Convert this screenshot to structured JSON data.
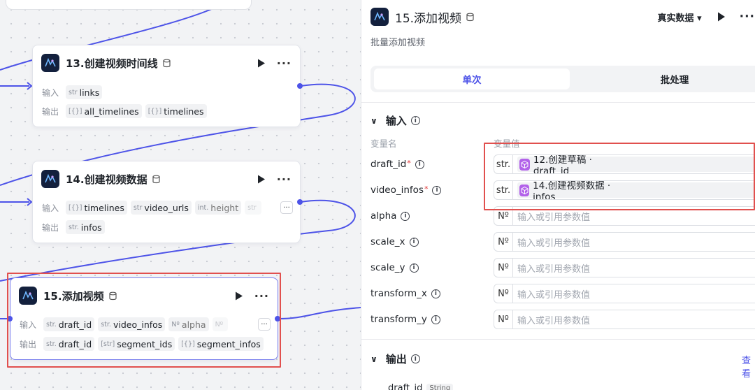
{
  "canvas": {
    "nodes": [
      {
        "title": "13.创建视频时间线",
        "input_label": "输入",
        "output_label": "输出",
        "inputs": [
          {
            "type": "str",
            "name": "links"
          }
        ],
        "outputs": [
          {
            "type": "[{}]",
            "name": "all_timelines"
          },
          {
            "type": "[{}]",
            "name": "timelines"
          }
        ]
      },
      {
        "title": "14.创建视频数据",
        "input_label": "输入",
        "output_label": "输出",
        "inputs": [
          {
            "type": "[{}]",
            "name": "timelines"
          },
          {
            "type": "str",
            "name": "video_urls"
          },
          {
            "type": "int.",
            "name": "height"
          },
          {
            "type": "str",
            "name": ""
          }
        ],
        "outputs": [
          {
            "type": "str.",
            "name": "infos"
          }
        ]
      },
      {
        "title": "15.添加视频",
        "input_label": "输入",
        "output_label": "输出",
        "inputs": [
          {
            "type": "str.",
            "name": "draft_id"
          },
          {
            "type": "str.",
            "name": "video_infos"
          },
          {
            "type": "Nº",
            "name": "alpha"
          },
          {
            "type": "Nº",
            "name": ""
          }
        ],
        "outputs": [
          {
            "type": "str.",
            "name": "draft_id"
          },
          {
            "type": "[str]",
            "name": "segment_ids"
          },
          {
            "type": "[{}]",
            "name": "segment_infos"
          }
        ]
      }
    ],
    "colors": {
      "wire": "#4d53e8",
      "highlight": "#e1504e"
    }
  },
  "panel": {
    "title": "15.添加视频",
    "mode": "真实数据",
    "description": "批量添加视频",
    "tabs": [
      "单次",
      "批处理"
    ],
    "input_section": "输入",
    "col_name": "变量名",
    "col_value": "变量值",
    "params": [
      {
        "name": "draft_id",
        "required": true,
        "type": "str.",
        "ref": "12.创建草稿 · draft_id"
      },
      {
        "name": "video_infos",
        "required": true,
        "type": "str.",
        "ref": "14.创建视频数据 · infos"
      },
      {
        "name": "alpha",
        "required": false,
        "type": "Nº",
        "placeholder": "输入或引用参数值"
      },
      {
        "name": "scale_x",
        "required": false,
        "type": "Nº",
        "placeholder": "输入或引用参数值"
      },
      {
        "name": "scale_y",
        "required": false,
        "type": "Nº",
        "placeholder": "输入或引用参数值"
      },
      {
        "name": "transform_x",
        "required": false,
        "type": "Nº",
        "placeholder": "输入或引用参数值"
      },
      {
        "name": "transform_y",
        "required": false,
        "type": "Nº",
        "placeholder": "输入或引用参数值"
      }
    ],
    "output_section": "输出",
    "view_link": "查看",
    "output_first": {
      "name": "draft_id",
      "type": "String"
    }
  },
  "icons": [
    "workflow-node-icon",
    "database-icon",
    "play-icon",
    "more-icon",
    "chevron-down-icon",
    "info-icon",
    "plugin-cube-icon"
  ]
}
